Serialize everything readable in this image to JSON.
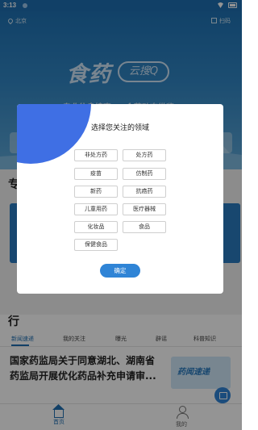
{
  "status_bar": {
    "time": "3:13"
  },
  "header": {
    "location": "北京",
    "scan_label": "扫码"
  },
  "hero": {
    "logo_text": "食药",
    "logo_sub": "云搜Q",
    "slogan_1": "专业信息搜索",
    "slogan_2": "食药动态纵览"
  },
  "section": {
    "heading_char": "专",
    "news_char": "行"
  },
  "tabs": [
    "新闻速递",
    "我的关注",
    "曝光",
    "辟谣",
    "科普知识"
  ],
  "article": {
    "title": "国家药监局关于同意湖北、湖南省药监局开展优化药品补充申请审...",
    "thumb_label": "药闻速递"
  },
  "bottom_nav": {
    "home": "首页",
    "mine": "我的"
  },
  "modal": {
    "title": "选择您关注的领域",
    "options": [
      "非处方药",
      "处方药",
      "疫苗",
      "仿制药",
      "新药",
      "抗癌药",
      "儿童用药",
      "医疗器械",
      "化妆品",
      "食品",
      "保健食品"
    ],
    "confirm_label": "确定"
  },
  "colors": {
    "brand_blue": "#1f6fb2",
    "accent_blob": "#3f6fe4",
    "confirm_button": "#2f84d6"
  }
}
